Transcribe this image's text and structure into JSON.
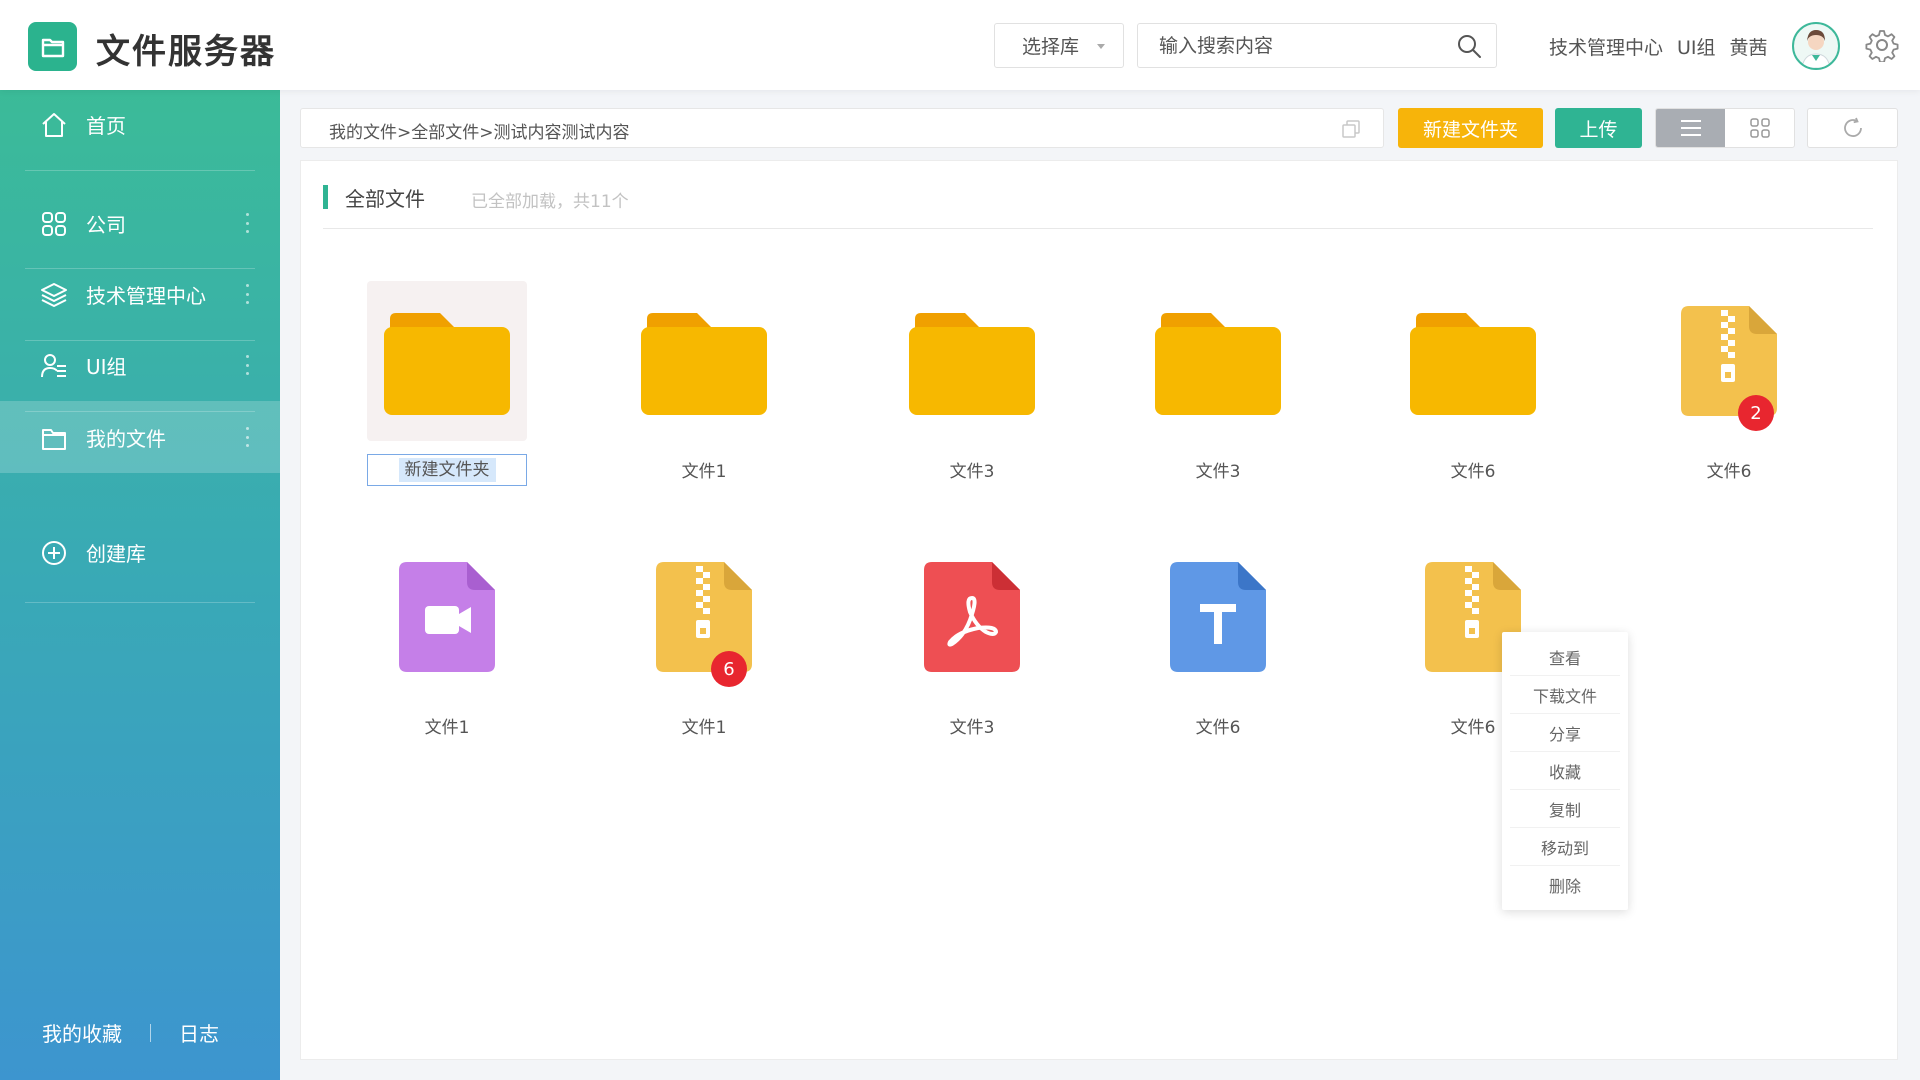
{
  "header": {
    "app_title": "文件服务器",
    "library_select": "选择库",
    "search_placeholder": "输入搜索内容",
    "user_dept": "技术管理中心",
    "user_group": "UI组",
    "user_name": "黄茜"
  },
  "sidebar": {
    "items": [
      {
        "label": "首页",
        "icon": "home-icon"
      },
      {
        "label": "公司",
        "icon": "grid-icon"
      },
      {
        "label": "技术管理中心",
        "icon": "layers-icon"
      },
      {
        "label": "UI组",
        "icon": "group-icon"
      },
      {
        "label": "我的文件",
        "icon": "folder-icon"
      },
      {
        "label": "创建库",
        "icon": "plus-circle-icon"
      }
    ],
    "footer": {
      "favorites": "我的收藏",
      "log": "日志"
    }
  },
  "toolbar": {
    "breadcrumb": "我的文件>全部文件>测试内容测试内容",
    "new_folder": "新建文件夹",
    "upload": "上传"
  },
  "panel": {
    "title": "全部文件",
    "subtitle": "已全部加载，共11个"
  },
  "files": [
    {
      "name": "新建文件夹",
      "type": "folder"
    },
    {
      "name": "文件1",
      "type": "folder"
    },
    {
      "name": "文件3",
      "type": "folder"
    },
    {
      "name": "文件3",
      "type": "folder"
    },
    {
      "name": "文件6",
      "type": "folder"
    },
    {
      "name": "文件6",
      "type": "zip",
      "badge": "2"
    },
    {
      "name": "文件1",
      "type": "video"
    },
    {
      "name": "文件1",
      "type": "zip",
      "badge": "6"
    },
    {
      "name": "文件3",
      "type": "pdf"
    },
    {
      "name": "文件6",
      "type": "text"
    },
    {
      "name": "文件6",
      "type": "zip"
    }
  ],
  "context_menu": [
    "查看",
    "下载文件",
    "分享",
    "收藏",
    "复制",
    "移动到",
    "删除"
  ],
  "colors": {
    "accent": "#2fb493",
    "folder": "#f7b800",
    "badge": "#e8262f",
    "video": "#c57fe8",
    "pdf": "#ee4f53",
    "text": "#5f98e6",
    "zip": "#f3c14d"
  }
}
